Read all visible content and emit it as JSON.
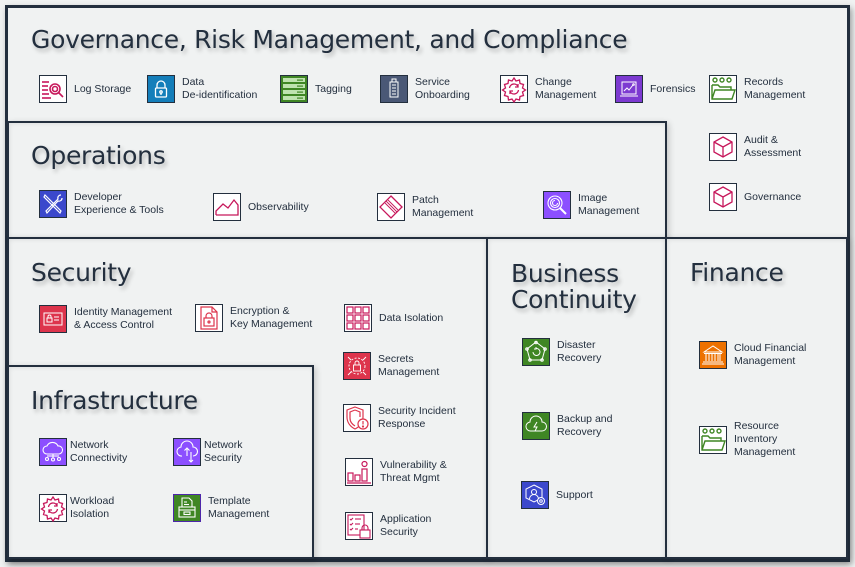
{
  "colors": {
    "border": "#232f3e",
    "background": "#f0f2f2",
    "pink": "#c7175b",
    "red": "#dd344c",
    "blue": "#147eba",
    "green": "#3f8624",
    "purple": "#8c4fff",
    "indigo": "#4d27aa",
    "slate": "#4a5876",
    "orange": "#ed7100"
  },
  "sections": {
    "governance": {
      "title": "Governance, Risk Management, and Compliance",
      "items": [
        {
          "label": "Log Storage",
          "icon": "log-storage-icon"
        },
        {
          "label": "Data\nDe-identification",
          "icon": "lock-icon"
        },
        {
          "label": "Tagging",
          "icon": "tagging-icon"
        },
        {
          "label": "Service\nOnboarding",
          "icon": "building-icon"
        },
        {
          "label": "Change\nManagement",
          "icon": "gear-refresh-icon"
        },
        {
          "label": "Forensics",
          "icon": "chart-monitor-icon"
        },
        {
          "label": "Records\nManagement",
          "icon": "folder-icon"
        },
        {
          "label": "Audit &\nAssessment",
          "icon": "cube-icon"
        },
        {
          "label": "Governance",
          "icon": "cube-icon"
        }
      ]
    },
    "operations": {
      "title": "Operations",
      "items": [
        {
          "label": "Developer\nExperience & Tools",
          "icon": "tools-icon"
        },
        {
          "label": "Observability",
          "icon": "line-chart-icon"
        },
        {
          "label": "Patch\nManagement",
          "icon": "patch-icon"
        },
        {
          "label": "Image\nManagement",
          "icon": "magnifier-icon"
        }
      ]
    },
    "security": {
      "title": "Security",
      "items": [
        {
          "label": "Identity Management\n& Access Control",
          "icon": "id-card-icon"
        },
        {
          "label": "Encryption &\nKey Management",
          "icon": "encrypted-file-icon"
        },
        {
          "label": "Data Isolation",
          "icon": "grid-icon"
        },
        {
          "label": "Secrets\nManagement",
          "icon": "secrets-lock-icon"
        },
        {
          "label": "Security Incident\nResponse",
          "icon": "shield-alert-icon"
        },
        {
          "label": "Vulnerability &\nThreat Mgmt",
          "icon": "bar-chart-icon"
        },
        {
          "label": "Application\nSecurity",
          "icon": "checklist-lock-icon"
        }
      ]
    },
    "infrastructure": {
      "title": "Infrastructure",
      "items": [
        {
          "label": "Network\nConnectivity",
          "icon": "cloud-network-icon"
        },
        {
          "label": "Network\nSecurity",
          "icon": "cloud-upload-icon"
        },
        {
          "label": "Workload\nIsolation",
          "icon": "gear-refresh-icon"
        },
        {
          "label": "Template\nManagement",
          "icon": "template-icon"
        }
      ]
    },
    "business_continuity": {
      "title": "Business\nContinuity",
      "items": [
        {
          "label": "Disaster\nRecovery",
          "icon": "recovery-icon"
        },
        {
          "label": "Backup and\nRecovery",
          "icon": "cloud-bolt-icon"
        },
        {
          "label": "Support",
          "icon": "support-icon"
        }
      ]
    },
    "finance": {
      "title": "Finance",
      "items": [
        {
          "label": "Cloud Financial\nManagement",
          "icon": "bank-icon"
        },
        {
          "label": "Resource\nInventory\nManagement",
          "icon": "folder-icon"
        }
      ]
    }
  }
}
